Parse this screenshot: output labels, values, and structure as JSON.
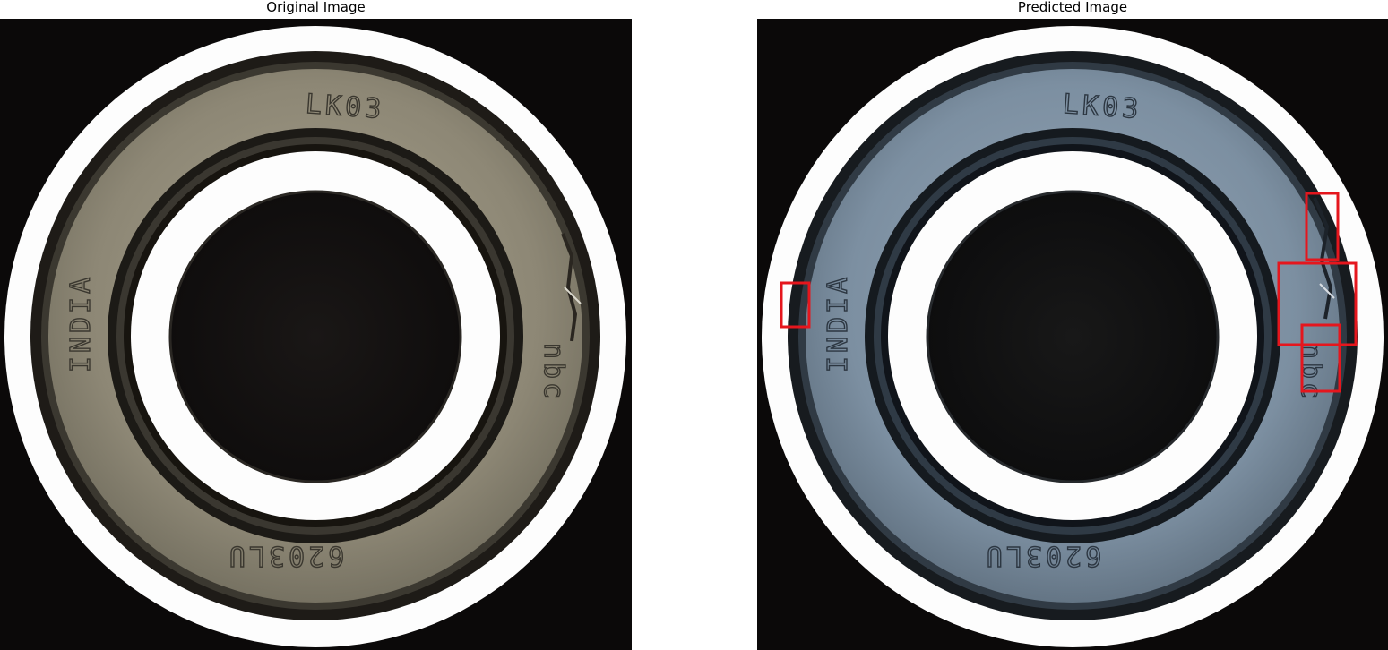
{
  "panels": [
    {
      "title": "Original Image",
      "markings": {
        "top": "LK03",
        "left": "INDIA",
        "right": "nbc",
        "bottom": "6203LU"
      },
      "tint": "original"
    },
    {
      "title": "Predicted Image",
      "markings": {
        "top": "LK03",
        "left": "INDIA",
        "right": "nbc",
        "bottom": "6203LU"
      },
      "tint": "predicted",
      "detections": 4
    }
  ],
  "colors": {
    "background": "#0b0909",
    "ring_white": "#fdfdfd",
    "seal_original": "#8f8a78",
    "seal_predicted": "#7f92a4",
    "detection_box": "#e5161d"
  }
}
